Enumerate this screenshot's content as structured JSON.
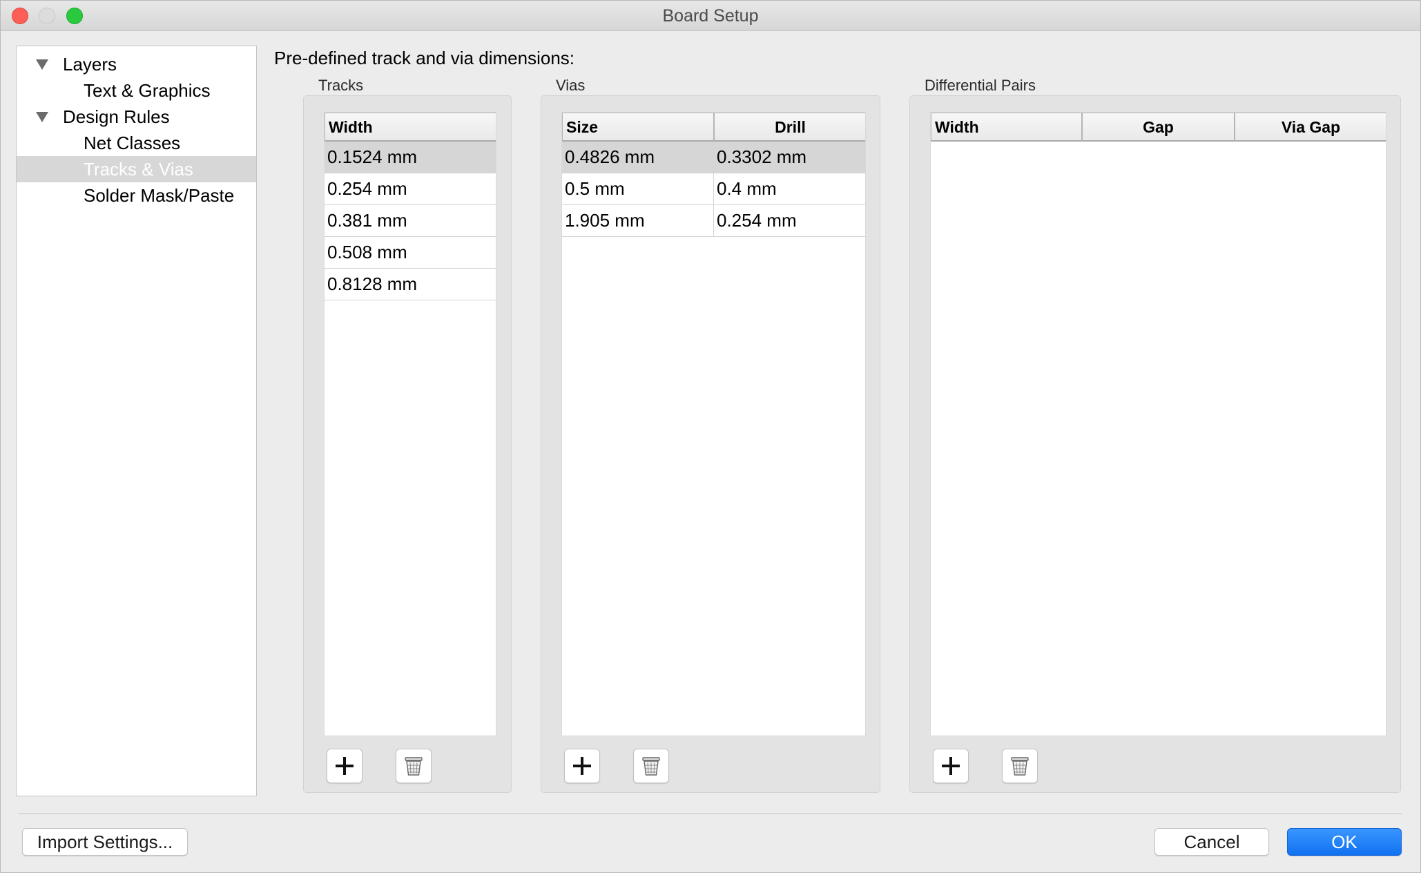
{
  "window": {
    "title": "Board Setup"
  },
  "tree": {
    "items": [
      {
        "label": "Layers",
        "expanded": true
      },
      {
        "label": "Text & Graphics"
      },
      {
        "label": "Design Rules",
        "expanded": true
      },
      {
        "label": "Net Classes"
      },
      {
        "label": "Tracks & Vias",
        "selected": true
      },
      {
        "label": "Solder Mask/Paste"
      }
    ]
  },
  "main": {
    "heading": "Pre-defined track and via dimensions:",
    "tracks": {
      "label": "Tracks",
      "columns": [
        "Width"
      ],
      "rows": [
        [
          "0.1524 mm"
        ],
        [
          "0.254 mm"
        ],
        [
          "0.381 mm"
        ],
        [
          "0.508 mm"
        ],
        [
          "0.8128 mm"
        ]
      ],
      "selected_row": 0
    },
    "vias": {
      "label": "Vias",
      "columns": [
        "Size",
        "Drill"
      ],
      "rows": [
        [
          "0.4826 mm",
          "0.3302 mm"
        ],
        [
          "0.5 mm",
          "0.4 mm"
        ],
        [
          "1.905 mm",
          "0.254 mm"
        ]
      ],
      "selected_row": 0
    },
    "diff_pairs": {
      "label": "Differential Pairs",
      "columns": [
        "Width",
        "Gap",
        "Via Gap"
      ],
      "rows": []
    },
    "icons": {
      "add": "plus-icon",
      "delete": "trash-icon"
    }
  },
  "footer": {
    "import_label": "Import Settings...",
    "cancel_label": "Cancel",
    "ok_label": "OK"
  },
  "colors": {
    "accent": "#1a7cf5",
    "selection": "#d6d6d6",
    "close": "#fd5f57",
    "maximize": "#29c940"
  }
}
